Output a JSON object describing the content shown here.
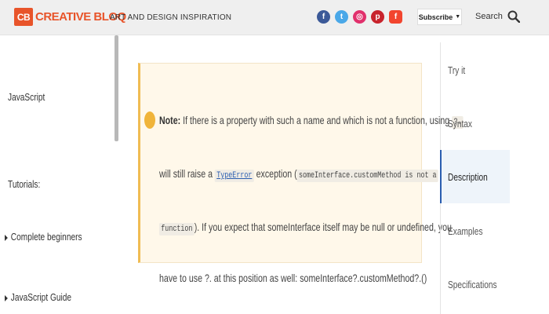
{
  "header": {
    "logo_badge": "CB",
    "logo_text": "CREATIVE BLOQ",
    "tagline": "ART AND DESIGN INSPIRATION",
    "socials": [
      {
        "icon": "facebook-icon",
        "glyph": "f",
        "color": "#3b5998"
      },
      {
        "icon": "twitter-icon",
        "glyph": "t",
        "color": "#4aa8e8"
      },
      {
        "icon": "instagram-icon",
        "glyph": "◎",
        "color": "#e1306c"
      },
      {
        "icon": "pinterest-icon",
        "glyph": "p",
        "color": "#c8232c"
      },
      {
        "icon": "flipboard-icon",
        "glyph": "f",
        "color": "#f2452e"
      }
    ],
    "subscribe_label": "Subscribe",
    "subscribe_caret": "▼",
    "search_label": "Search"
  },
  "sidebar": {
    "items": [
      {
        "label": "JavaScript",
        "has_arrow": false
      },
      {
        "label": "Tutorials:",
        "has_arrow": false
      },
      {
        "label": "Complete beginners",
        "has_arrow": true
      },
      {
        "label": "JavaScript Guide",
        "has_arrow": true
      }
    ]
  },
  "note": {
    "label": "Note:",
    "line1_a": " If there is a property with such a name and which is not a function, using ",
    "line1_code": "?.",
    "line2_a": "will still raise a ",
    "line2_link": "TypeError",
    "line2_b": " exception (",
    "line2_code": "someInterface.customMethod is not a",
    "line3_code": "function",
    "line3_b": "). If you expect that someInterface itself may be null or undefined, you",
    "line4": "have to use ?. at this position as well: someInterface?.customMethod?.()"
  },
  "toc": {
    "items": [
      {
        "label": "Try it"
      },
      {
        "label": "Syntax"
      },
      {
        "label": "Description",
        "active": true
      },
      {
        "label": "Examples"
      },
      {
        "label": "Specifications"
      }
    ]
  },
  "colors": {
    "brand": "#e8542a",
    "note_bg": "#fff8ea",
    "note_border": "#f0bc53",
    "link": "#2a5db0"
  }
}
